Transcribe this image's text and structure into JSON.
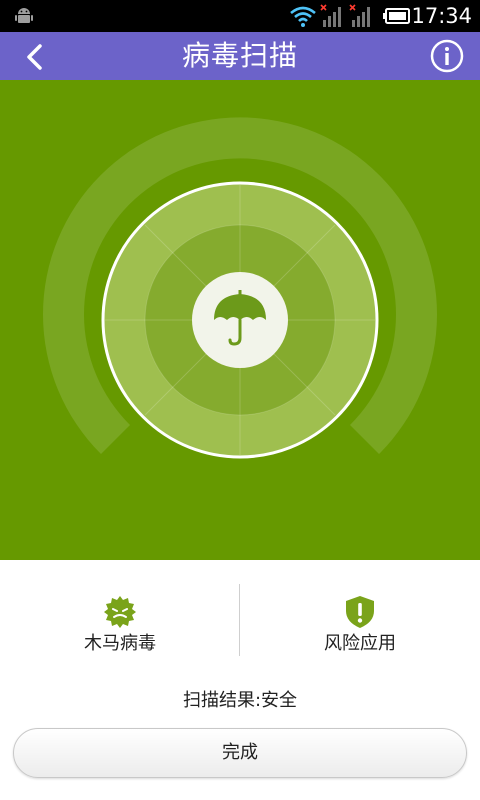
{
  "status_bar": {
    "time": "17:34",
    "icons": [
      "android-icon",
      "wifi-icon",
      "signal-no-service-icon",
      "signal-no-service-icon",
      "battery-icon"
    ]
  },
  "header": {
    "title": "病毒扫描",
    "back_icon": "chevron-left-icon",
    "info_icon": "info-icon",
    "color": "#6c63c9"
  },
  "scan": {
    "background_color": "#669900",
    "center_icon": "umbrella-icon"
  },
  "stats": [
    {
      "label": "木马病毒",
      "icon": "virus-icon",
      "color": "#7aa31a"
    },
    {
      "label": "风险应用",
      "icon": "shield-alert-icon",
      "color": "#7aa31a"
    }
  ],
  "result_text": "扫描结果:安全",
  "done_button": "完成"
}
